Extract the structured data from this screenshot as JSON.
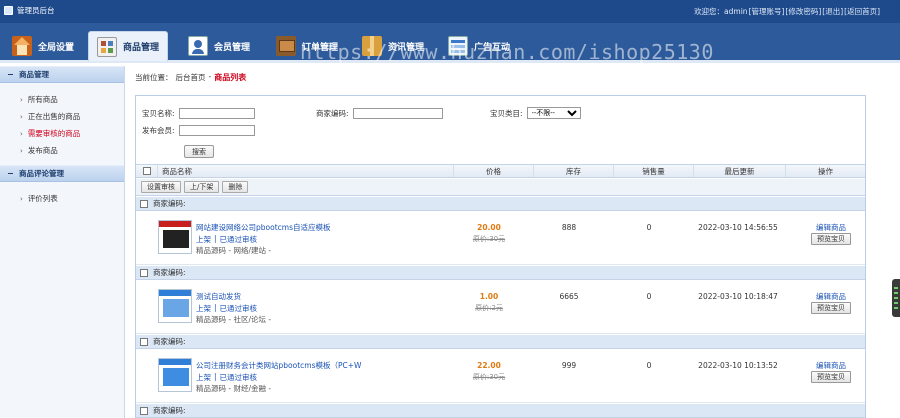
{
  "topbar": {
    "title": "管理员后台",
    "links": [
      "欢迎您：admin",
      "[管理账号]",
      "[修改密码]",
      "[退出]",
      "[返回首页]"
    ]
  },
  "tabs": [
    {
      "label": "全局设置",
      "icon": "home-icon"
    },
    {
      "label": "商品管理",
      "icon": "goods-icon",
      "active": true
    },
    {
      "label": "会员管理",
      "icon": "member-icon"
    },
    {
      "label": "订单管理",
      "icon": "order-icon"
    },
    {
      "label": "资讯管理",
      "icon": "news-icon"
    },
    {
      "label": "广告互动",
      "icon": "ad-icon"
    }
  ],
  "watermark": "https://www.huzhan.com/ishop25130",
  "sidebar": {
    "sections": [
      {
        "title": "商品管理",
        "items": [
          "所有商品",
          "正在出售的商品",
          "需要审核的商品",
          "发布商品"
        ],
        "highlight_index": 2
      },
      {
        "title": "商品评论管理",
        "items": [
          "评价列表"
        ]
      }
    ]
  },
  "breadcrumb": {
    "prefix": "当前位置：",
    "home": "后台首页",
    "sep": "-",
    "current": "商品列表"
  },
  "search": {
    "name_label": "宝贝名称:",
    "code_label": "商家编码:",
    "type_label": "宝贝类目:",
    "type_value": "--不限--",
    "publisher_label": "发布会员:",
    "button": "搜索"
  },
  "table": {
    "headers": [
      "商品名称",
      "价格",
      "库存",
      "销售量",
      "最后更新",
      "操作"
    ],
    "actions": [
      "设置审核",
      "上/下架",
      "删除"
    ],
    "group_label": "商家编码:",
    "status_sep": "|",
    "products": [
      {
        "name": "网站建设网络公司pbootcms自适应模板",
        "status": "上架",
        "audit": "已通过审核",
        "category": "精品源码 - 网络/建站 -",
        "price": "20.00",
        "old_price": "原价:30元",
        "stock": "888",
        "sold": "0",
        "updated": "2022-03-10 14:56:55",
        "edit": "编辑商品",
        "preview": "预览宝贝",
        "thumb_color": "#c81e1e"
      },
      {
        "name": "测试自动发货",
        "status": "上架",
        "audit": "已通过审核",
        "category": "精品源码 - 社区/论坛 -",
        "price": "1.00",
        "old_price": "原价:2元",
        "stock": "6665",
        "sold": "0",
        "updated": "2022-03-10 10:18:47",
        "edit": "编辑商品",
        "preview": "预览宝贝",
        "thumb_color": "#2f7ed8"
      },
      {
        "name": "公司注册财务会计类网站pbootcms模板（PC+W",
        "status": "上架",
        "audit": "已通过审核",
        "category": "精品源码 - 财经/金融 -",
        "price": "22.00",
        "old_price": "原价:30元",
        "stock": "999",
        "sold": "0",
        "updated": "2022-03-10 10:13:52",
        "edit": "编辑商品",
        "preview": "预览宝贝",
        "thumb_color": "#2f7ed8"
      }
    ]
  }
}
